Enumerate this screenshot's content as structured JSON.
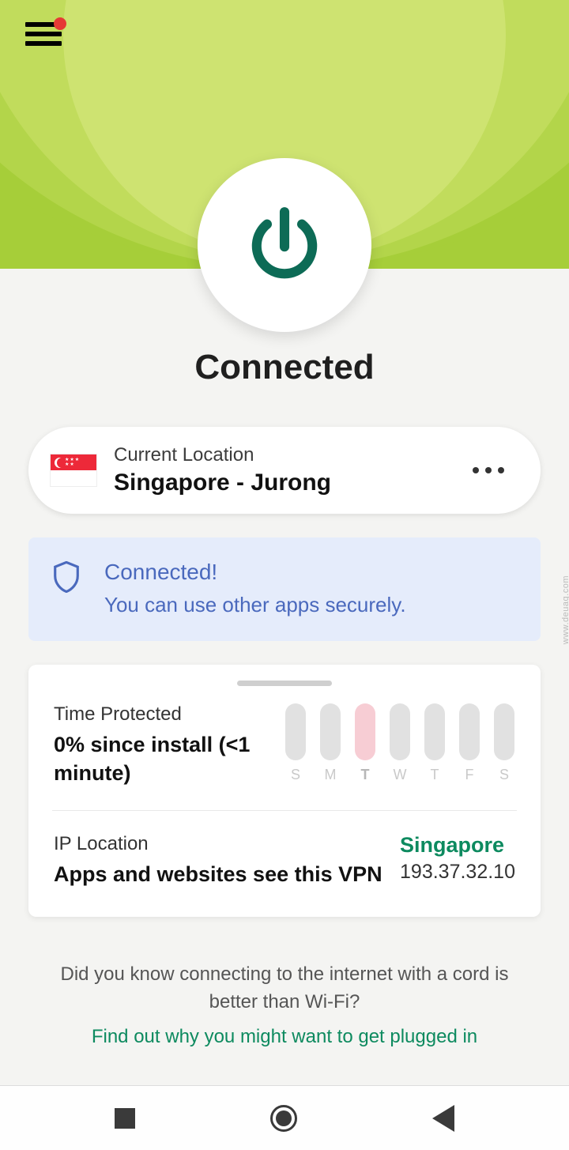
{
  "status": "Connected",
  "location": {
    "label": "Current Location",
    "value": "Singapore - Jurong",
    "flag": "singapore"
  },
  "banner": {
    "title": "Connected!",
    "subtitle": "You can use other apps securely."
  },
  "time_protected": {
    "label": "Time Protected",
    "value": "0% since install (<1 minute)",
    "days": [
      {
        "letter": "S",
        "highlight": false
      },
      {
        "letter": "M",
        "highlight": false
      },
      {
        "letter": "T",
        "highlight": true
      },
      {
        "letter": "W",
        "highlight": false
      },
      {
        "letter": "T",
        "highlight": false
      },
      {
        "letter": "F",
        "highlight": false
      },
      {
        "letter": "S",
        "highlight": false
      }
    ]
  },
  "ip_location": {
    "label": "IP Location",
    "description": "Apps and websites see this VPN",
    "country": "Singapore",
    "ip": "193.37.32.10"
  },
  "tip": {
    "question": "Did you know connecting to the internet with a cord is better than Wi-Fi?",
    "link": "Find out why you might want to get plugged in"
  },
  "watermark": "www.deuaq.com"
}
